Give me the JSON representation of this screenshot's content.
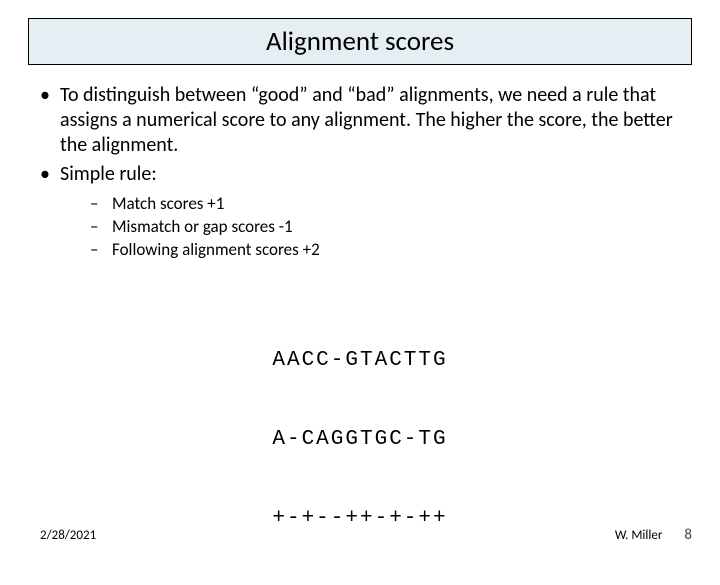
{
  "title": "Alignment scores",
  "bullets": {
    "b1": "To distinguish between “good” and “bad” alignments, we need a rule that assigns a numerical score to any alignment. The higher the score, the better the alignment.",
    "b2": "Simple rule:"
  },
  "sub": {
    "s1": "Match scores +1",
    "s2": "Mismatch or gap scores -1",
    "s3": "Following alignment scores +2"
  },
  "alignment": {
    "row1": "AACC-GTACTTG",
    "row2": "A-CAGGTGC-TG",
    "row3": "+-+--++-+-++"
  },
  "footer": {
    "date": "2/28/2021",
    "author": "W. Miller",
    "page": "8"
  }
}
